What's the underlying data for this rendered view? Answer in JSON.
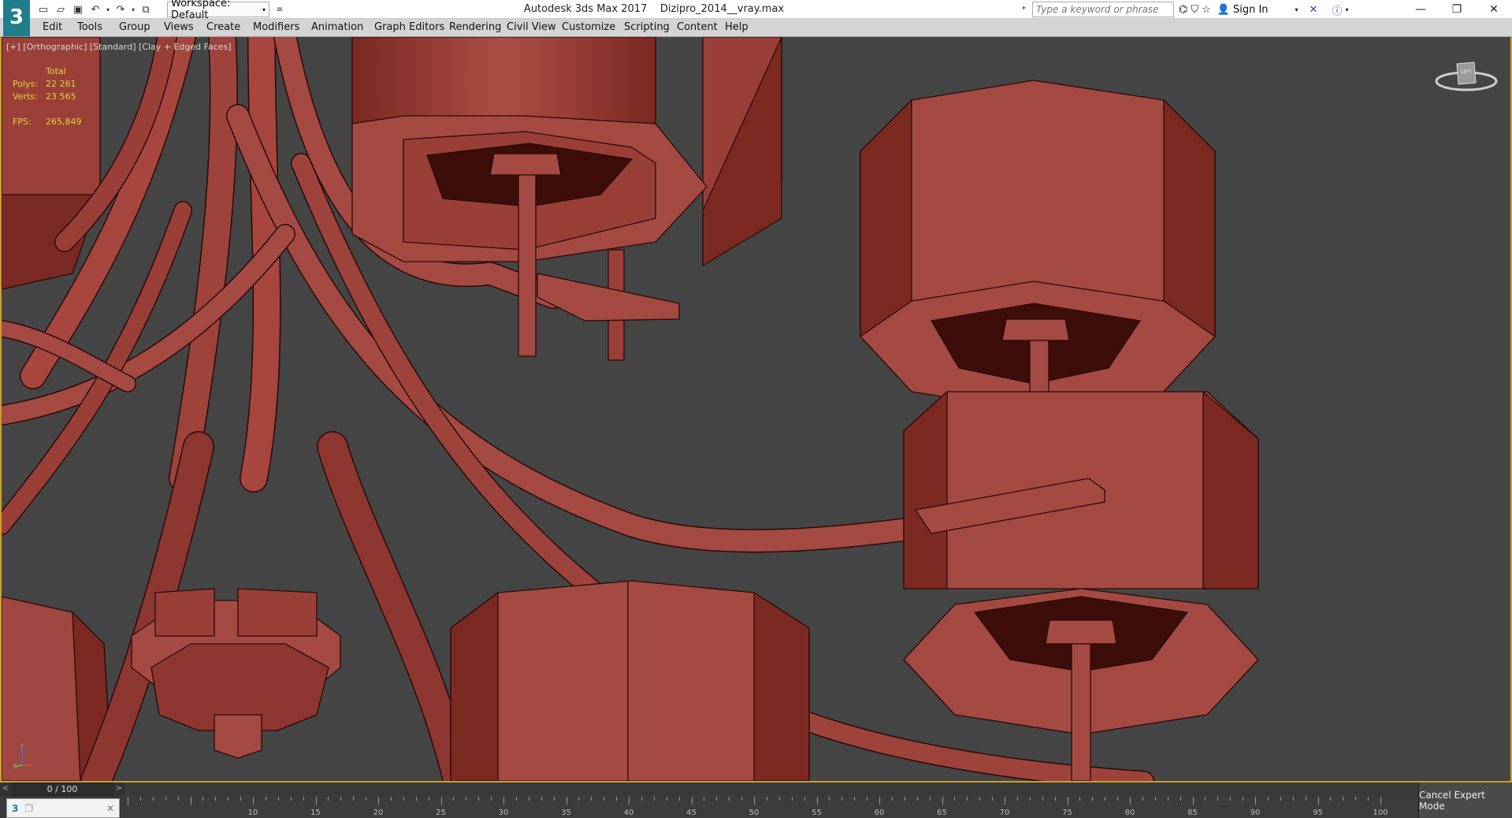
{
  "window": {
    "app_name": "Autodesk 3ds Max 2017",
    "file_name": "Dizipro_2014__vray.max",
    "workspace_label": "Workspace: Default",
    "search_placeholder": "Type a keyword or phrase",
    "sign_in": "Sign In",
    "app_logo_text": "3"
  },
  "menu": {
    "items": [
      "Edit",
      "Tools",
      "Group",
      "Views",
      "Create",
      "Modifiers",
      "Animation",
      "Graph Editors",
      "Rendering",
      "Civil View",
      "Customize",
      "Scripting",
      "Content",
      "Help"
    ]
  },
  "viewport": {
    "label": "[+] [Orthographic] [Standard] [Clay + Edged Faces]",
    "stats": {
      "total_label": "Total",
      "polys_label": "Polys:",
      "polys_value": "22 261",
      "verts_label": "Verts:",
      "verts_value": "23 565",
      "fps_label": "FPS:",
      "fps_value": "265,849"
    },
    "viewcube_label": "LEFT",
    "model_color": "#a44a43",
    "model_dark": "#5e1b16",
    "model_light": "#b8564d",
    "edge_color": "#2a0a08",
    "background": "#454545"
  },
  "timeline": {
    "slider_text": "0 / 100",
    "ticks": [
      10,
      15,
      20,
      25,
      30,
      35,
      40,
      45,
      50,
      55,
      60,
      65,
      70,
      75,
      80,
      85,
      90,
      95,
      100
    ],
    "cancel_expert": "Cancel Expert Mode"
  },
  "icons": {
    "qa": [
      "new-file-icon",
      "open-file-icon",
      "save-icon",
      "undo-icon",
      "redo-icon",
      "project-icon"
    ],
    "title_right": [
      "binoculars-icon",
      "bookmark-icon",
      "star-icon",
      "user-icon",
      "x-tools-icon",
      "help-icon"
    ],
    "window_controls": [
      "minimize-icon",
      "restore-icon",
      "close-icon"
    ]
  }
}
